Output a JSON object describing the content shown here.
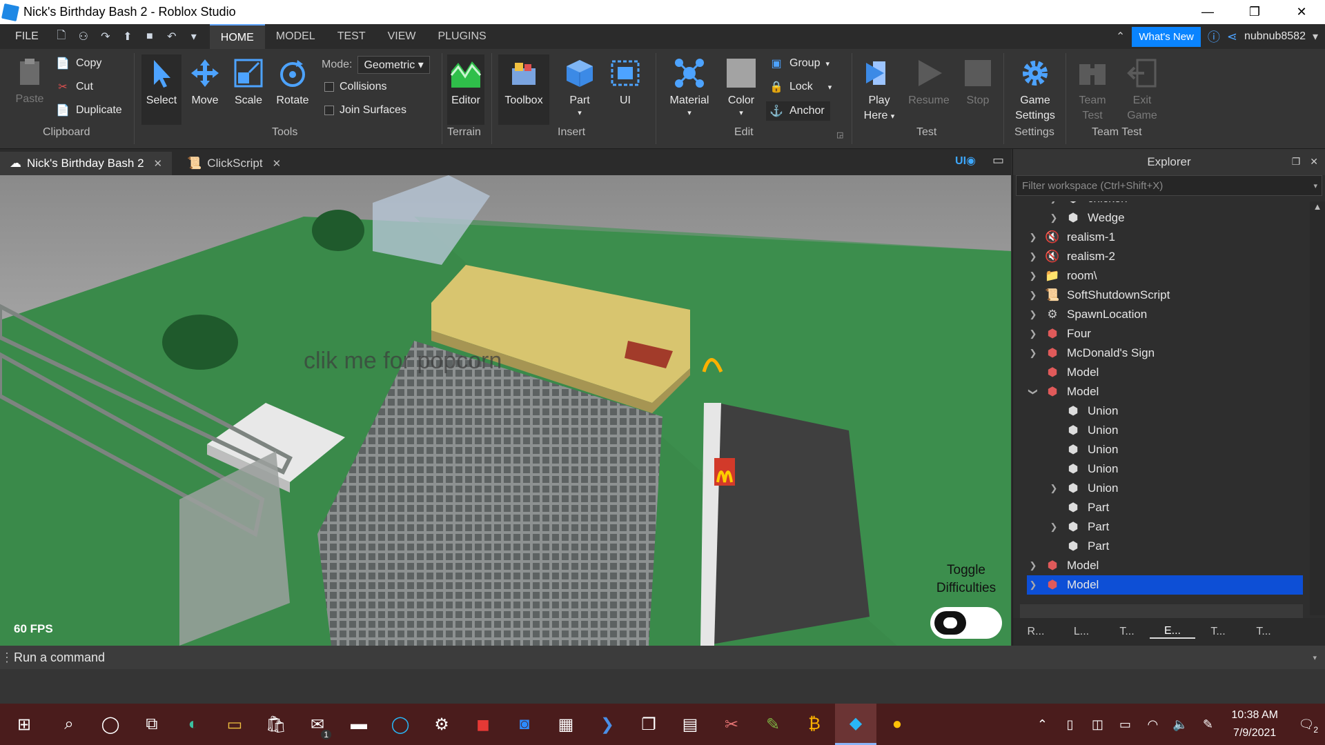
{
  "window": {
    "title": "Nick's Birthday Bash 2 - Roblox Studio"
  },
  "menu": {
    "file": "FILE",
    "tabs": [
      "HOME",
      "MODEL",
      "TEST",
      "VIEW",
      "PLUGINS"
    ],
    "whats_new": "What's New",
    "username": "nubnub8582"
  },
  "ribbon": {
    "clipboard": {
      "paste": "Paste",
      "copy": "Copy",
      "cut": "Cut",
      "duplicate": "Duplicate",
      "group_label": "Clipboard"
    },
    "tools": {
      "select": "Select",
      "move": "Move",
      "scale": "Scale",
      "rotate": "Rotate",
      "mode_label": "Mode:",
      "mode_value": "Geometric",
      "collisions": "Collisions",
      "join_surfaces": "Join Surfaces",
      "group_label": "Tools"
    },
    "terrain": {
      "editor": "Editor",
      "group_label": "Terrain"
    },
    "insert": {
      "toolbox": "Toolbox",
      "part": "Part",
      "ui": "UI",
      "group_label": "Insert"
    },
    "edit": {
      "material": "Material",
      "color": "Color",
      "group": "Group",
      "lock": "Lock",
      "anchor": "Anchor",
      "group_label": "Edit"
    },
    "test": {
      "play_here_1": "Play",
      "play_here_2": "Here",
      "resume": "Resume",
      "stop": "Stop",
      "group_label": "Test"
    },
    "settings": {
      "game_settings_1": "Game",
      "game_settings_2": "Settings",
      "group_label": "Settings"
    },
    "team_test": {
      "team_test_1": "Team",
      "team_test_2": "Test",
      "exit_game_1": "Exit",
      "exit_game_2": "Game",
      "group_label": "Team Test"
    }
  },
  "doc_tabs": [
    {
      "label": "Nick's Birthday Bash 2"
    },
    {
      "label": "ClickScript"
    }
  ],
  "viewport": {
    "billboard": "clik me for popcorn",
    "fps": "60 FPS",
    "toggle_label_1": "Toggle",
    "toggle_label_2": "Difficulties",
    "ui_toggle": "UI"
  },
  "explorer": {
    "title": "Explorer",
    "filter_placeholder": "Filter workspace (Ctrl+Shift+X)",
    "items": [
      {
        "label": "chicken"
      },
      {
        "label": "Wedge"
      },
      {
        "label": "realism-1"
      },
      {
        "label": "realism-2"
      },
      {
        "label": "room\\"
      },
      {
        "label": "SoftShutdownScript"
      },
      {
        "label": "SpawnLocation"
      },
      {
        "label": "Four"
      },
      {
        "label": "McDonald's Sign"
      },
      {
        "label": "Model"
      },
      {
        "label": "Model"
      },
      {
        "label": "Union"
      },
      {
        "label": "Union"
      },
      {
        "label": "Union"
      },
      {
        "label": "Union"
      },
      {
        "label": "Union"
      },
      {
        "label": "Part"
      },
      {
        "label": "Part"
      },
      {
        "label": "Part"
      },
      {
        "label": "Model"
      },
      {
        "label": "Model"
      }
    ],
    "bottom_tabs": [
      "R...",
      "L...",
      "T...",
      "E...",
      "T...",
      "T..."
    ]
  },
  "command_bar": {
    "placeholder": "Run a command"
  },
  "taskbar": {
    "time": "10:38 AM",
    "date": "7/9/2021",
    "notifications": "2",
    "mail_badge": "1"
  },
  "colors": {
    "accent": "#0a84ff",
    "selection": "#0d4fd6",
    "taskbar": "#4a1c1c"
  }
}
